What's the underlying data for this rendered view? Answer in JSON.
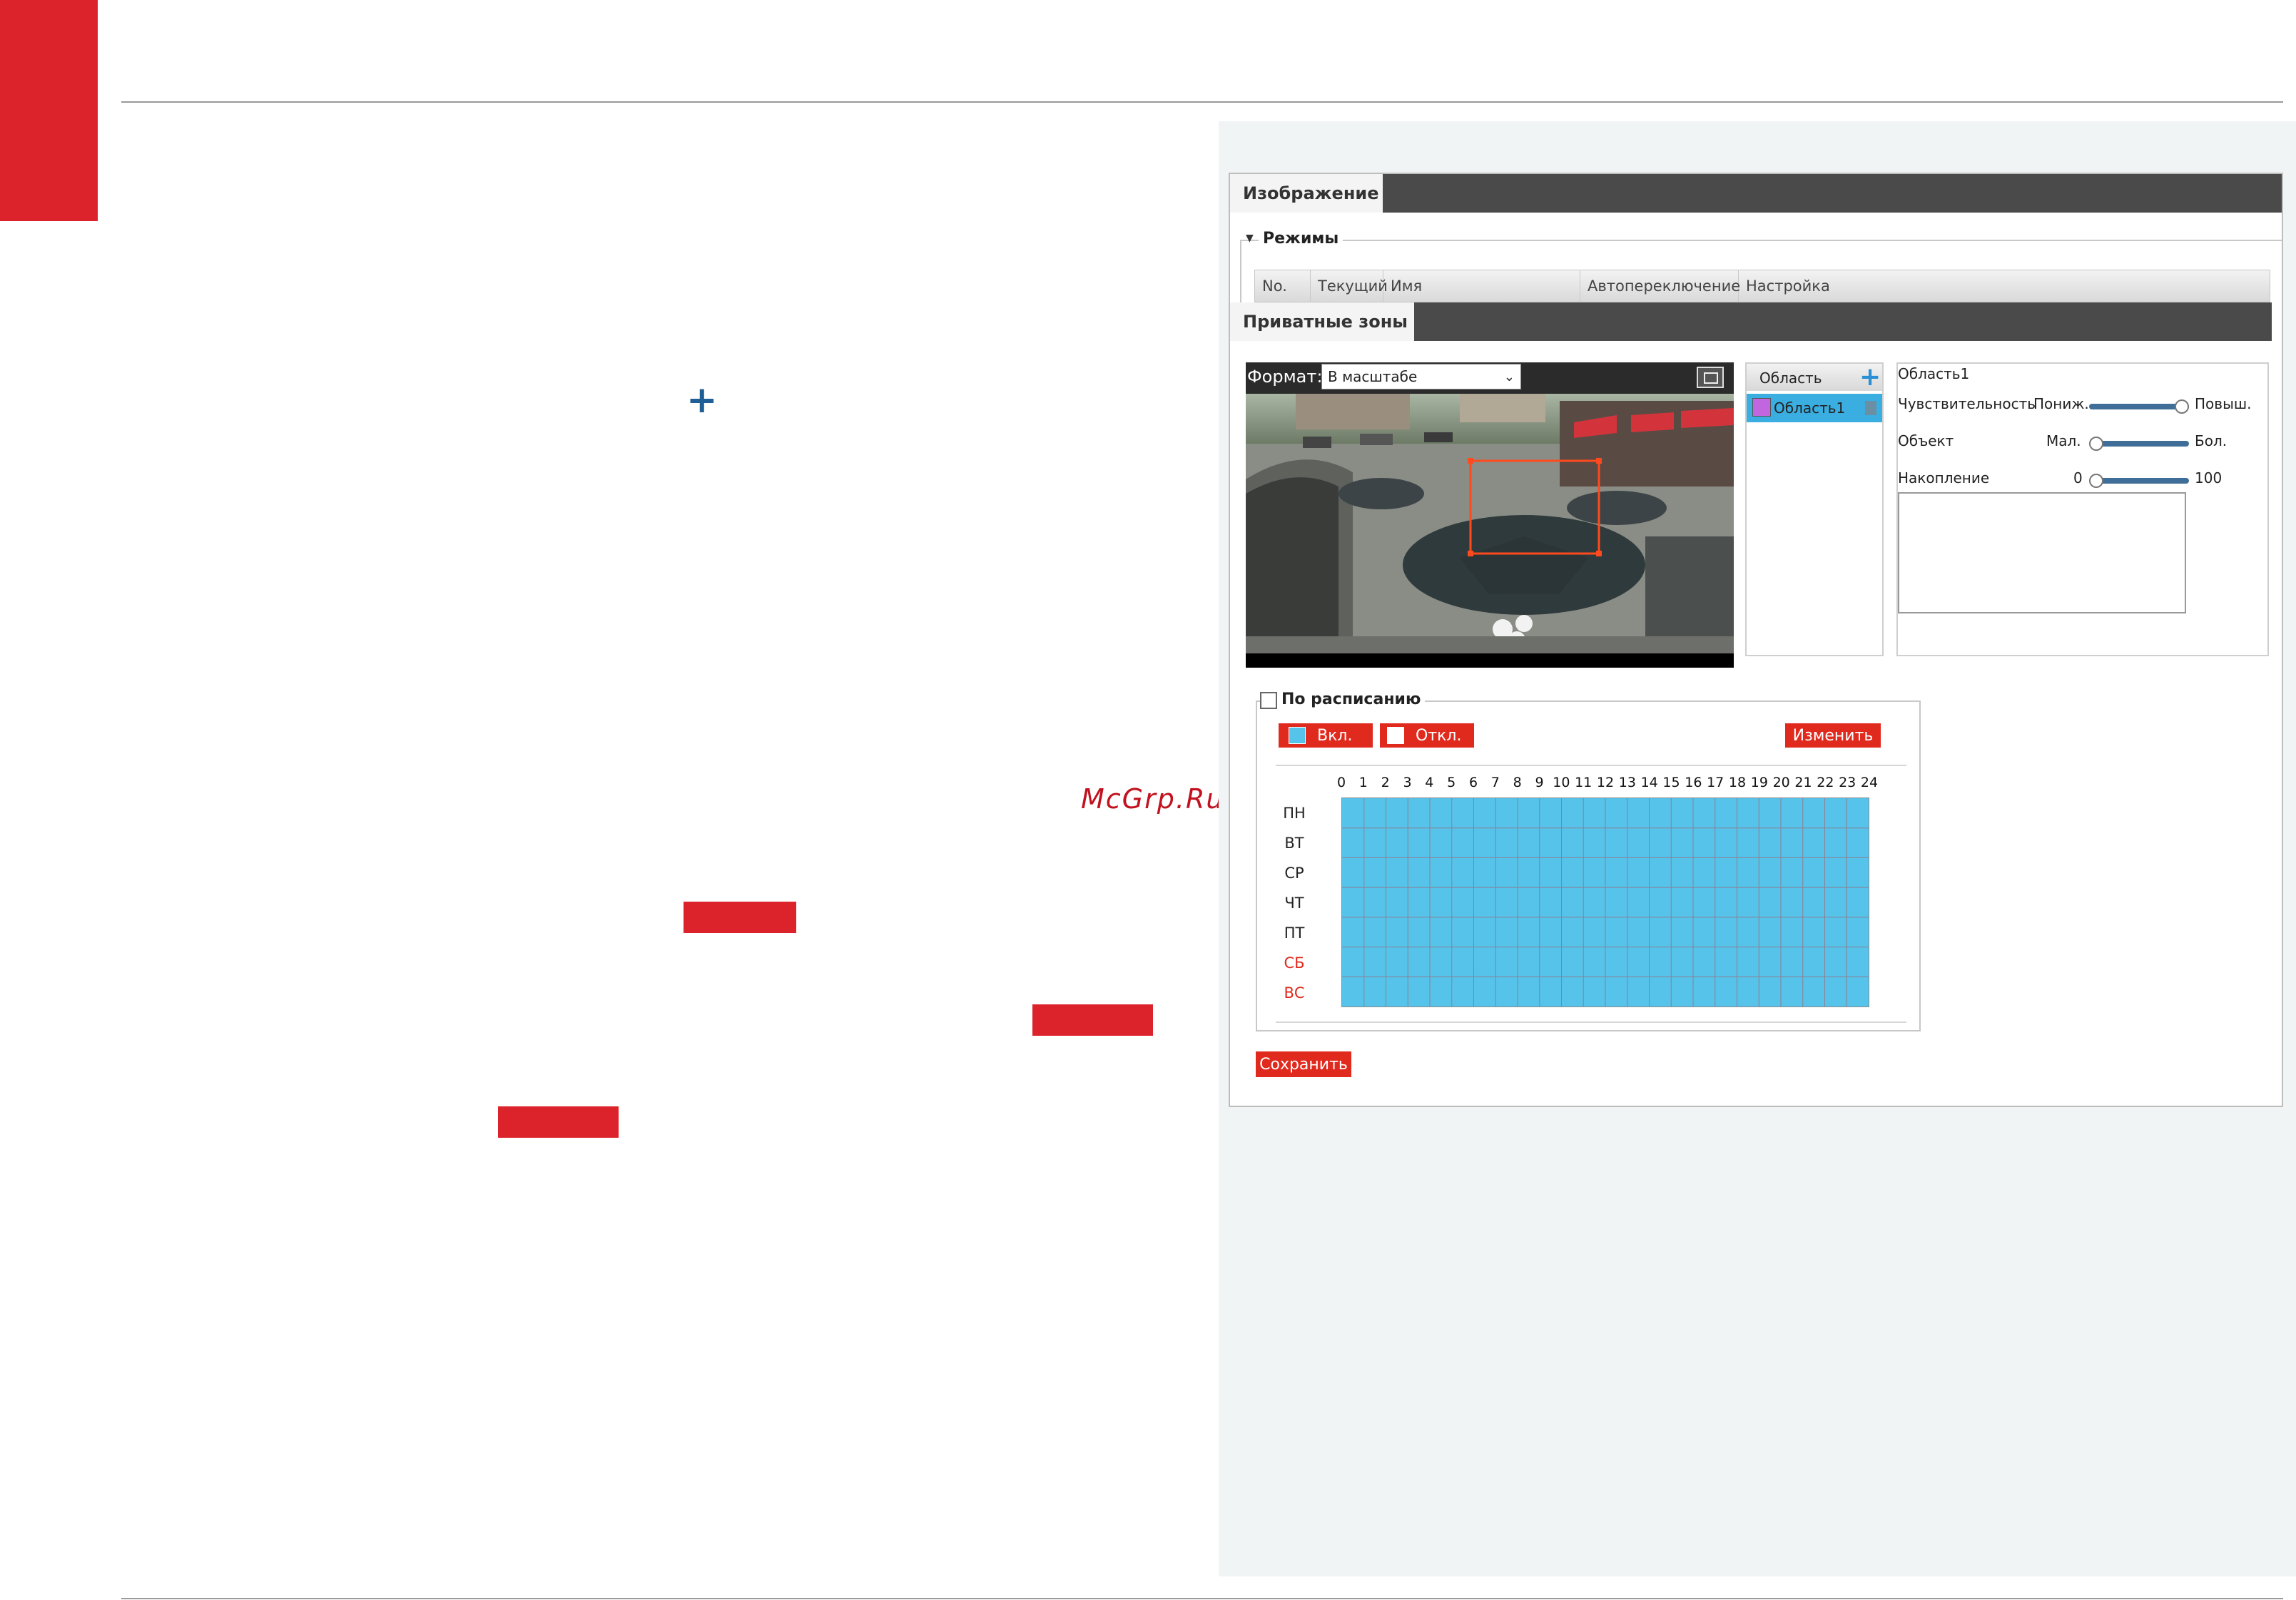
{
  "page": {
    "watermark": "McGrp.Ru"
  },
  "ui": {
    "tab_image": "Изображение",
    "modes_legend": "Режимы",
    "modes_table_headers": [
      "No.",
      "Текущий",
      "Имя",
      "Автопереключение",
      "Настройка"
    ],
    "tab_privacy": "Приватные зоны",
    "format_label": "Формат:",
    "format_value": "В масштабе",
    "area_list_header": "Область",
    "area_items": [
      {
        "label": "Область1",
        "color": "#c266e0"
      }
    ],
    "area_name": "Область1",
    "sensitivity_label": "Чувствительность",
    "sensitivity_min": "Пониж.",
    "sensitivity_max": "Повыш.",
    "sensitivity_level": 1.0,
    "object_label": "Объект",
    "object_min": "Мал.",
    "object_max": "Бол.",
    "object_level": 0.0,
    "accum_label": "Накопление",
    "accum_min": "0",
    "accum_max": "100",
    "accum_level": 0.0,
    "schedule_label": "По расписанию",
    "schedule_checked": false,
    "btn_on": "Вкл.",
    "btn_off": "Откл.",
    "btn_edit": "Изменить",
    "hours": [
      "0",
      "1",
      "2",
      "3",
      "4",
      "5",
      "6",
      "7",
      "8",
      "9",
      "10",
      "11",
      "12",
      "13",
      "14",
      "15",
      "16",
      "17",
      "18",
      "19",
      "20",
      "21",
      "22",
      "23",
      "24"
    ],
    "days": [
      {
        "label": "ПН",
        "weekend": false
      },
      {
        "label": "ВТ",
        "weekend": false
      },
      {
        "label": "СР",
        "weekend": false
      },
      {
        "label": "ЧТ",
        "weekend": false
      },
      {
        "label": "ПТ",
        "weekend": false
      },
      {
        "label": "СБ",
        "weekend": true
      },
      {
        "label": "ВС",
        "weekend": true
      }
    ],
    "save": "Сохранить"
  },
  "colors": {
    "brand_red": "#dc232b",
    "button_red": "#e02a1e",
    "schedule_fill": "#55c3ea",
    "tab_dark": "#4a4a4a",
    "selection_blue": "#3aaee0"
  }
}
